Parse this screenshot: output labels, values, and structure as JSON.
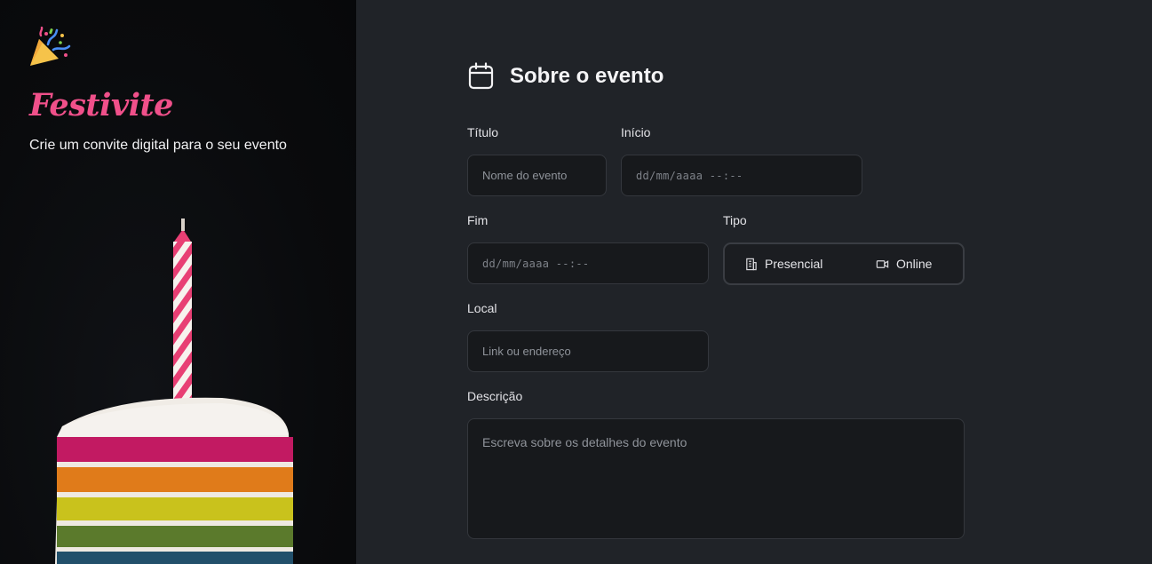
{
  "brand": {
    "name": "Festivite",
    "tagline": "Crie um convite digital para o seu evento"
  },
  "section": {
    "title": "Sobre o evento"
  },
  "form": {
    "titulo": {
      "label": "Título",
      "placeholder": "Nome do evento"
    },
    "inicio": {
      "label": "Início",
      "placeholder": "dd/mm/aaaa --:--"
    },
    "fim": {
      "label": "Fim",
      "placeholder": "dd/mm/aaaa --:--"
    },
    "tipo": {
      "label": "Tipo",
      "options": [
        {
          "label": "Presencial",
          "icon": "building-icon"
        },
        {
          "label": "Online",
          "icon": "video-icon"
        }
      ]
    },
    "local": {
      "label": "Local",
      "placeholder": "Link ou endereço"
    },
    "descricao": {
      "label": "Descrição",
      "placeholder": "Escreva sobre os detalhes do evento"
    }
  },
  "colors": {
    "brand_pink": "#f0508a",
    "panel_bg": "#202328",
    "field_bg": "#17191c"
  }
}
